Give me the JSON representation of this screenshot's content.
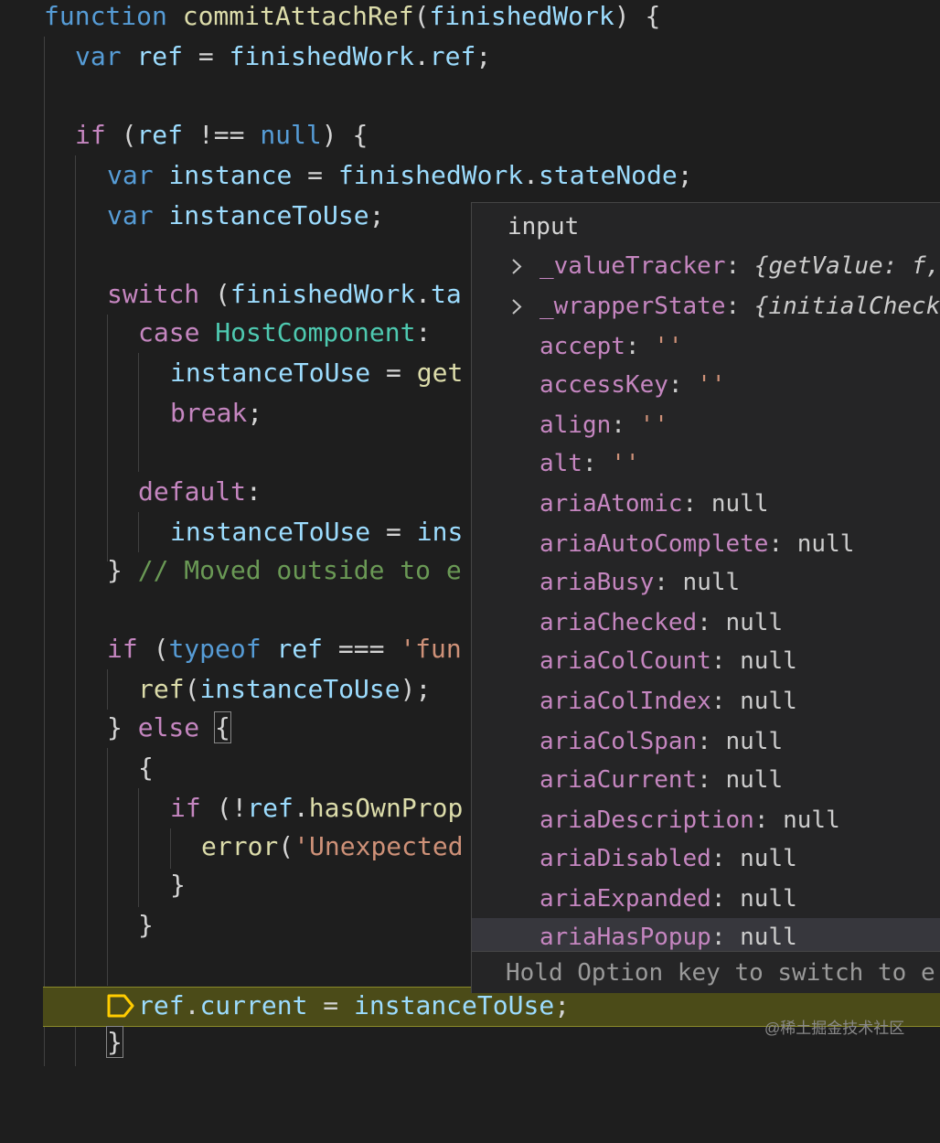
{
  "code": {
    "l1": {
      "t1": "function",
      "t2": " ",
      "t3": "commitAttachRef",
      "t4": "(",
      "t5": "finishedWork",
      "t6": ") {"
    },
    "l2": {
      "t1": "var",
      "t2": " ",
      "t3": "ref",
      "t4": " = ",
      "t5": "finishedWork",
      "t6": ".",
      "t7": "ref",
      "t8": ";"
    },
    "l4": {
      "t1": "if",
      "t2": " (",
      "t3": "ref",
      "t4": " !== ",
      "t5": "null",
      "t6": ") {"
    },
    "l5": {
      "t1": "var",
      "t2": " ",
      "t3": "instance",
      "t4": " = ",
      "t5": "finishedWork",
      "t6": ".",
      "t7": "stateNode",
      "t8": ";"
    },
    "l6": {
      "t1": "var",
      "t2": " ",
      "t3": "instanceToUse",
      "t4": ";"
    },
    "l8": {
      "t1": "switch",
      "t2": " (",
      "t3": "finishedWork",
      "t4": ".",
      "t5": "ta"
    },
    "l9": {
      "t1": "case",
      "t2": " ",
      "t3": "HostComponent",
      "t4": ":"
    },
    "l10": {
      "t1": "instanceToUse",
      "t2": " = ",
      "t3": "get"
    },
    "l11": {
      "t1": "break",
      "t2": ";"
    },
    "l13": {
      "t1": "default",
      "t2": ":"
    },
    "l14": {
      "t1": "instanceToUse",
      "t2": " = ",
      "t3": "ins"
    },
    "l15": {
      "t1": "} ",
      "t2": "// Moved outside to e"
    },
    "l17": {
      "t1": "if",
      "t2": " (",
      "t3": "typeof",
      "t4": " ",
      "t5": "ref",
      "t6": " === ",
      "t7": "'fun"
    },
    "l18": {
      "t1": "ref",
      "t2": "(",
      "t3": "instanceToUse",
      "t4": ");"
    },
    "l19": {
      "t1": "} ",
      "t2": "else",
      "t3": " ",
      "t4": "{"
    },
    "l20": {
      "t1": "{"
    },
    "l21": {
      "t1": "if",
      "t2": " (!",
      "t3": "ref",
      "t4": ".",
      "t5": "hasOwnProp"
    },
    "l22": {
      "t1": "error",
      "t2": "(",
      "t3": "'Unexpected"
    },
    "l23": {
      "t1": "}"
    },
    "l24": {
      "t1": "}"
    },
    "l26": {
      "t1": "ref",
      "t2": ".",
      "t3": "current",
      "t4": " = ",
      "t5": "instanceToUse",
      "t6": ";"
    },
    "l27": {
      "t1": "}"
    }
  },
  "hover": {
    "title": "input",
    "items": [
      {
        "key": "_valueTracker",
        "sep": ": ",
        "value": "{getValue: ",
        "value2": "f",
        "value3": ","
      },
      {
        "key": "_wrapperState",
        "sep": ": ",
        "value": "{initialCheck"
      },
      {
        "key": "accept",
        "sep": ": ",
        "value": "''"
      },
      {
        "key": "accessKey",
        "sep": ": ",
        "value": "''"
      },
      {
        "key": "align",
        "sep": ": ",
        "value": "''"
      },
      {
        "key": "alt",
        "sep": ": ",
        "value": "''"
      },
      {
        "key": "ariaAtomic",
        "sep": ": ",
        "value": "null"
      },
      {
        "key": "ariaAutoComplete",
        "sep": ": ",
        "value": "null"
      },
      {
        "key": "ariaBusy",
        "sep": ": ",
        "value": "null"
      },
      {
        "key": "ariaChecked",
        "sep": ": ",
        "value": "null"
      },
      {
        "key": "ariaColCount",
        "sep": ": ",
        "value": "null"
      },
      {
        "key": "ariaColIndex",
        "sep": ": ",
        "value": "null"
      },
      {
        "key": "ariaColSpan",
        "sep": ": ",
        "value": "null"
      },
      {
        "key": "ariaCurrent",
        "sep": ": ",
        "value": "null"
      },
      {
        "key": "ariaDescription",
        "sep": ": ",
        "value": "null"
      },
      {
        "key": "ariaDisabled",
        "sep": ": ",
        "value": "null"
      },
      {
        "key": "ariaExpanded",
        "sep": ": ",
        "value": "null"
      },
      {
        "key": "ariaHasPopup",
        "sep": ": ",
        "value": "null"
      }
    ],
    "status": "Hold Option key to switch to e"
  },
  "watermark": "@稀土掘金技术社区",
  "colors": {
    "background": "#1e1e1e",
    "keyword": "#569cd6",
    "control_keyword": "#c586c0",
    "function": "#dcdcaa",
    "variable": "#9cdcfe",
    "type": "#4ec9b0",
    "string": "#ce9178",
    "comment": "#6a9955",
    "active_line": "#4b4b18",
    "breakpoint": "#ffcc00"
  }
}
